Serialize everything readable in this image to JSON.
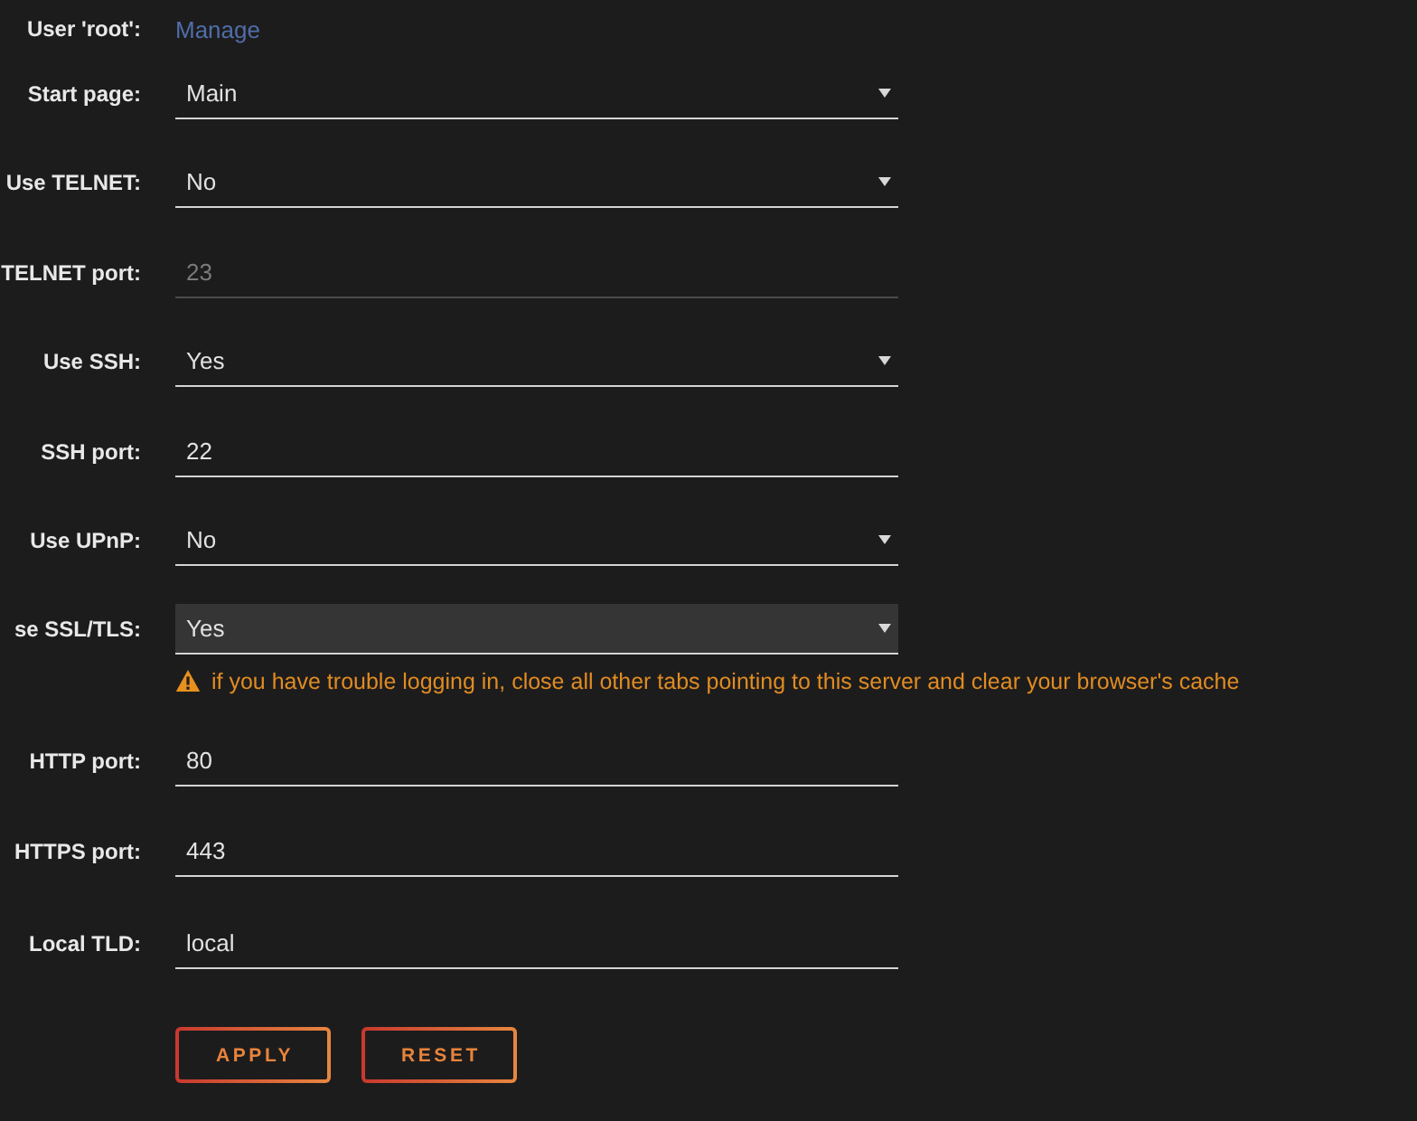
{
  "user_row": {
    "label": "User 'root':",
    "link": "Manage"
  },
  "fields": [
    {
      "kind": "select",
      "label": "Start page:",
      "value": "Main",
      "disabled": false,
      "focused": false
    },
    {
      "kind": "select",
      "label": "Use TELNET:",
      "value": "No",
      "disabled": false,
      "focused": false
    },
    {
      "kind": "text",
      "label": "TELNET port:",
      "value": "23",
      "disabled": true,
      "focused": false
    },
    {
      "kind": "select",
      "label": "Use SSH:",
      "value": "Yes",
      "disabled": false,
      "focused": false
    },
    {
      "kind": "text",
      "label": "SSH port:",
      "value": "22",
      "disabled": false,
      "focused": false
    },
    {
      "kind": "select",
      "label": "Use UPnP:",
      "value": "No",
      "disabled": false,
      "focused": false
    },
    {
      "kind": "select",
      "label": "se SSL/TLS:",
      "value": "Yes",
      "disabled": false,
      "focused": true,
      "warning": "if you have trouble logging in, close all other tabs pointing to this server and clear your browser's cache"
    },
    {
      "kind": "text",
      "label": "HTTP port:",
      "value": "80",
      "disabled": false,
      "focused": false
    },
    {
      "kind": "text",
      "label": "HTTPS port:",
      "value": "443",
      "disabled": false,
      "focused": false
    },
    {
      "kind": "text",
      "label": "Local TLD:",
      "value": "local",
      "disabled": false,
      "focused": false
    }
  ],
  "buttons": [
    {
      "label": "APPLY"
    },
    {
      "label": "RESET"
    }
  ]
}
